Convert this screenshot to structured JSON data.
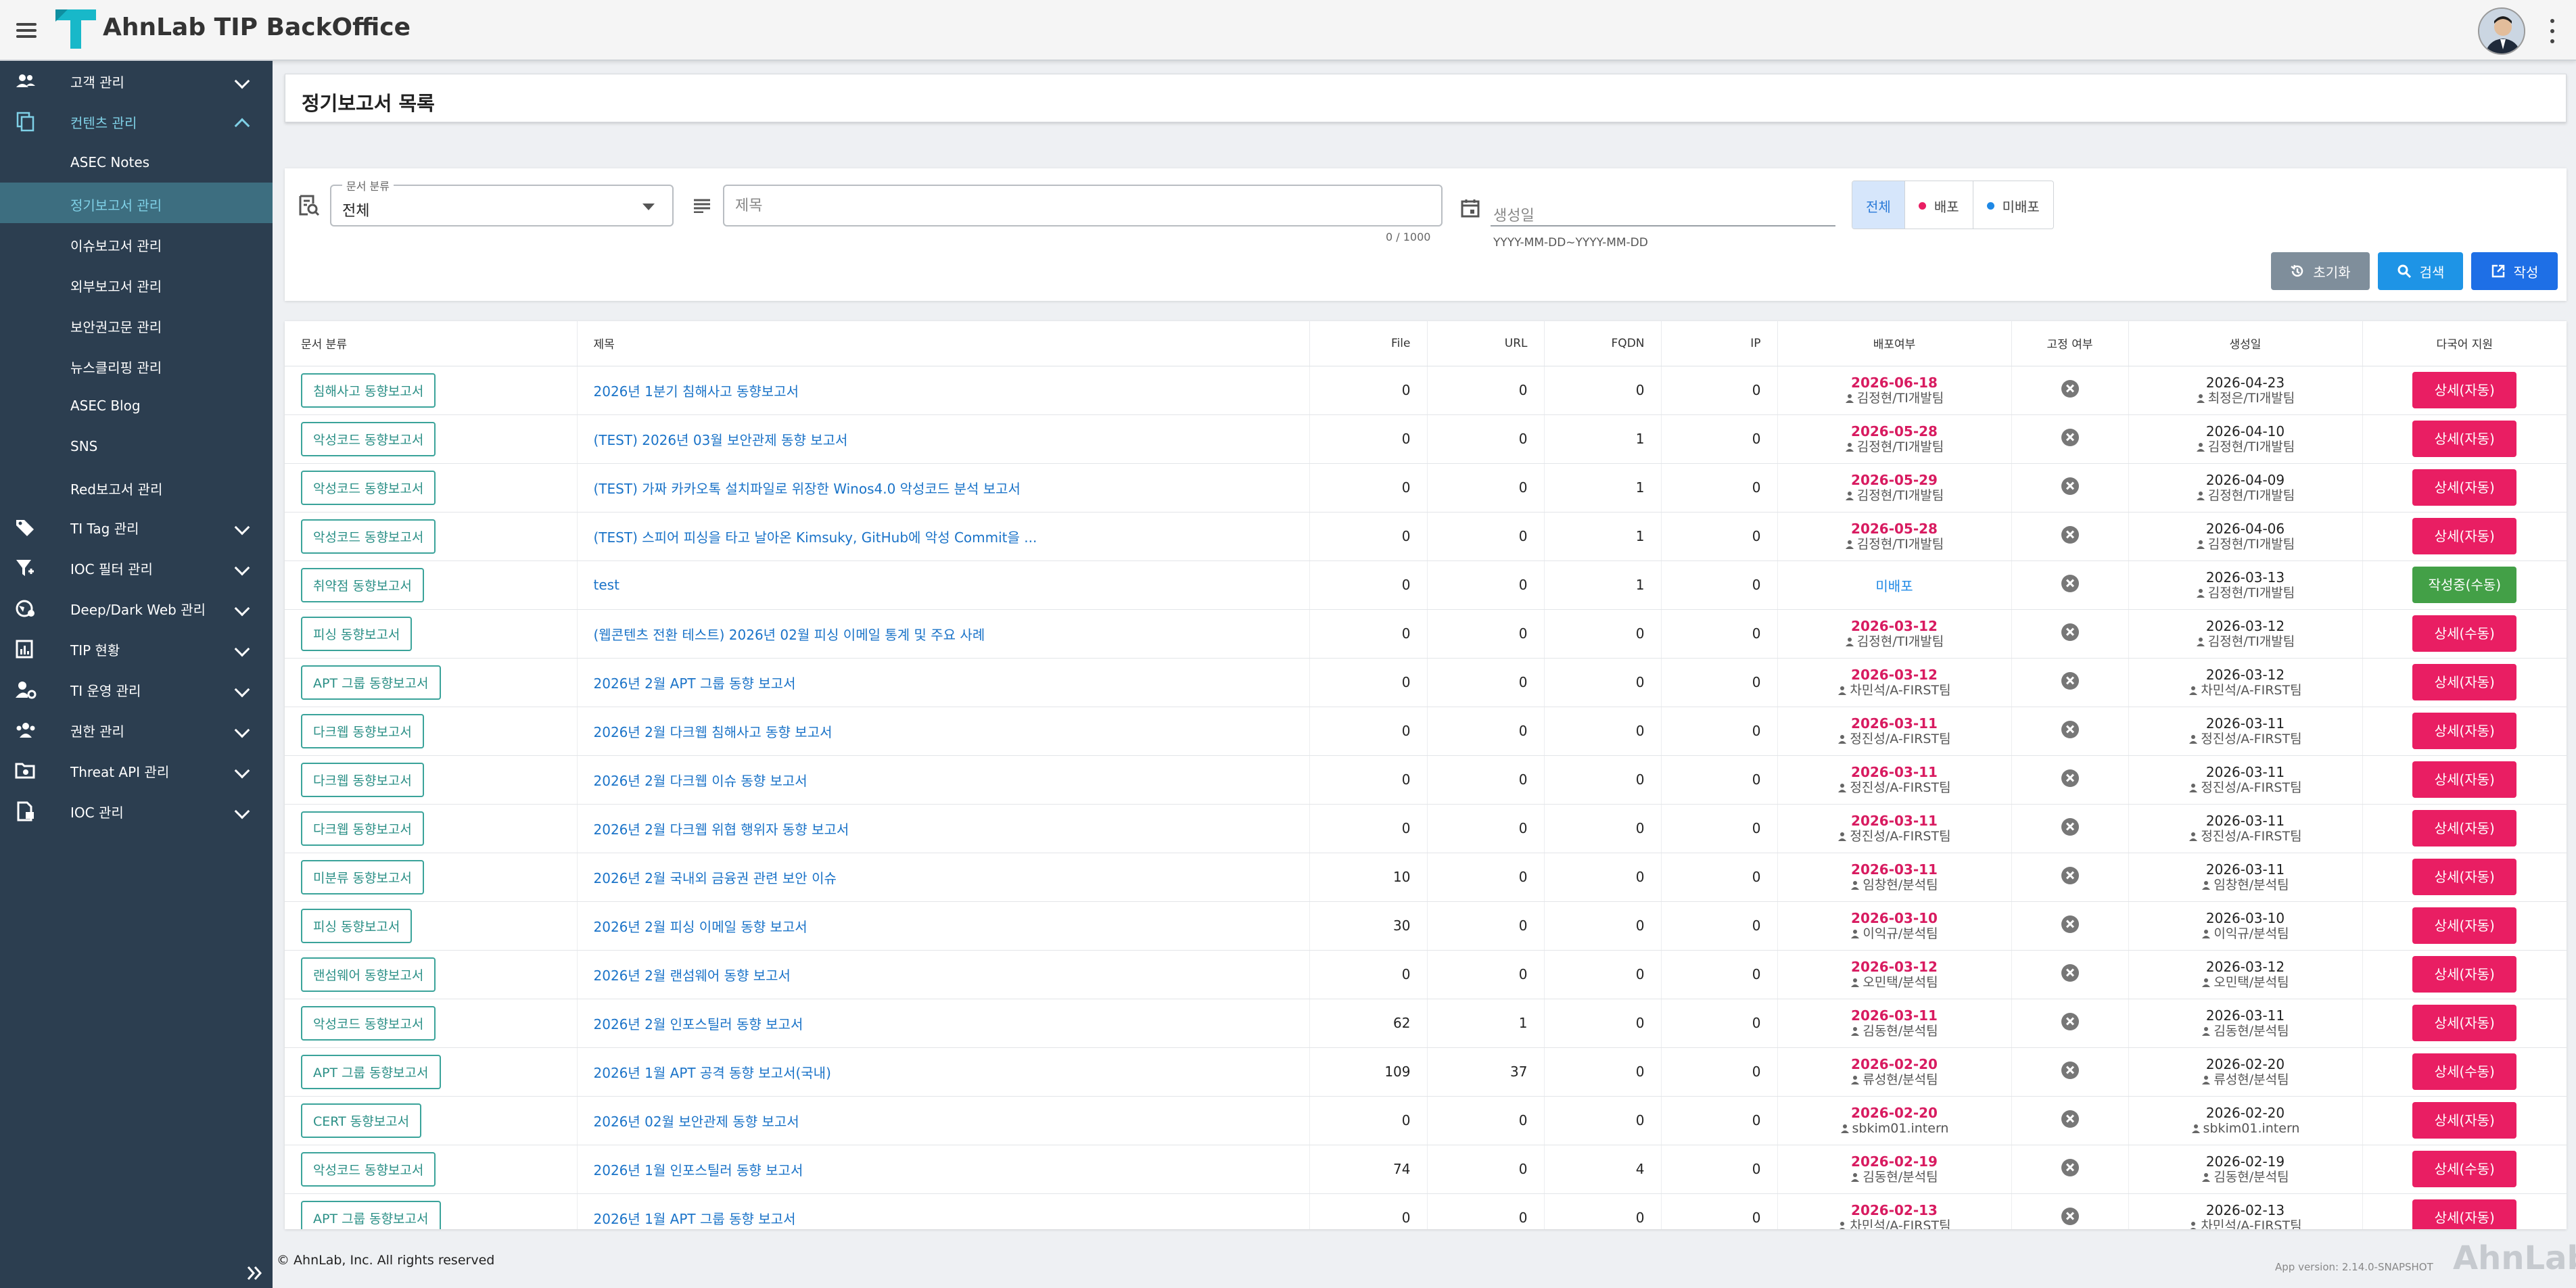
{
  "app": {
    "title": "AhnLab TIP BackOffice"
  },
  "colors": {
    "sidebar_bg": "#2c3e50",
    "accent": "#7fd0e6",
    "deploy_date": "#d81b60",
    "pink_button": "#e91e63",
    "green_button": "#43a047",
    "chip_border": "#3aa39a"
  },
  "sidebar": {
    "groups": [
      {
        "label": "고객 관리",
        "icon": "users-icon",
        "expanded": false
      },
      {
        "label": "컨텐츠 관리",
        "icon": "copy-icon",
        "expanded": true,
        "items": [
          "ASEC Notes",
          "정기보고서 관리",
          "이슈보고서 관리",
          "외부보고서 관리",
          "보안권고문 관리",
          "뉴스클리핑 관리",
          "ASEC Blog",
          "SNS",
          "Red보고서 관리"
        ],
        "active_item": "정기보고서 관리"
      },
      {
        "label": "TI Tag 관리",
        "icon": "tag-icon",
        "expanded": false
      },
      {
        "label": "IOC 필터 관리",
        "icon": "filter-icon",
        "expanded": false
      },
      {
        "label": "Deep/Dark Web 관리",
        "icon": "globe-icon",
        "expanded": false
      },
      {
        "label": "TIP 현황",
        "icon": "chart-icon",
        "expanded": false
      },
      {
        "label": "TI 운영 관리",
        "icon": "user-gear-icon",
        "expanded": false
      },
      {
        "label": "권한 관리",
        "icon": "group-icon",
        "expanded": false
      },
      {
        "label": "Threat API 관리",
        "icon": "folder-gear-icon",
        "expanded": false
      },
      {
        "label": "IOC 관리",
        "icon": "document-icon",
        "expanded": false
      }
    ]
  },
  "page": {
    "title": "정기보고서 목록"
  },
  "filters": {
    "category_label": "문서 분류",
    "category_value": "전체",
    "title_placeholder": "제목",
    "title_counter": "0 / 1000",
    "date_placeholder": "생성일",
    "date_helper": "YYYY-MM-DD~YYYY-MM-DD",
    "deploy_options": [
      "전체",
      "배포",
      "미배포"
    ],
    "deploy_selected": "전체",
    "reset_label": "초기화",
    "search_label": "검색",
    "write_label": "작성"
  },
  "table": {
    "headers": [
      "문서 분류",
      "제목",
      "File",
      "URL",
      "FQDN",
      "IP",
      "배포여부",
      "고정 여부",
      "생성일",
      "다국어 지원"
    ],
    "rows": [
      {
        "category": "침해사고 동향보고서",
        "title": "2026년 1분기 침해사고 동향보고서",
        "file": 0,
        "url": 0,
        "fqdn": 0,
        "ip": 0,
        "deploy_date": "2026-06-18",
        "deploy_by": "김정현/TI개발팀",
        "created": "2026-04-23",
        "created_by": "최정은/TI개발팀",
        "ml": "상세(자동)",
        "ml_color": "pink"
      },
      {
        "category": "악성코드 동향보고서",
        "title": "(TEST) 2026년 03월 보안관제 동향 보고서",
        "file": 0,
        "url": 0,
        "fqdn": 1,
        "ip": 0,
        "deploy_date": "2026-05-28",
        "deploy_by": "김정현/TI개발팀",
        "created": "2026-04-10",
        "created_by": "김정현/TI개발팀",
        "ml": "상세(자동)",
        "ml_color": "pink"
      },
      {
        "category": "악성코드 동향보고서",
        "title": "(TEST) 가짜 카카오톡 설치파일로 위장한 Winos4.0 악성코드 분석 보고서",
        "file": 0,
        "url": 0,
        "fqdn": 1,
        "ip": 0,
        "deploy_date": "2026-05-29",
        "deploy_by": "김정현/TI개발팀",
        "created": "2026-04-09",
        "created_by": "김정현/TI개발팀",
        "ml": "상세(자동)",
        "ml_color": "pink"
      },
      {
        "category": "악성코드 동향보고서",
        "title": "(TEST) 스피어 피싱을 타고 날아온 Kimsuky, GitHub에 악성 Commit을 ...",
        "file": 0,
        "url": 0,
        "fqdn": 1,
        "ip": 0,
        "deploy_date": "2026-05-28",
        "deploy_by": "김정현/TI개발팀",
        "created": "2026-04-06",
        "created_by": "김정현/TI개발팀",
        "ml": "상세(자동)",
        "ml_color": "pink"
      },
      {
        "category": "취약점 동향보고서",
        "title": "test",
        "file": 0,
        "url": 0,
        "fqdn": 1,
        "ip": 0,
        "deploy_date": "",
        "deploy_status": "미배포",
        "deploy_by": "",
        "created": "2026-03-13",
        "created_by": "김정현/TI개발팀",
        "ml": "작성중(수동)",
        "ml_color": "green"
      },
      {
        "category": "피싱 동향보고서",
        "title": "(웹콘텐츠 전환 테스트) 2026년 02월 피싱 이메일 통계 및 주요 사례",
        "file": 0,
        "url": 0,
        "fqdn": 0,
        "ip": 0,
        "deploy_date": "2026-03-12",
        "deploy_by": "김정현/TI개발팀",
        "created": "2026-03-12",
        "created_by": "김정현/TI개발팀",
        "ml": "상세(수동)",
        "ml_color": "pink"
      },
      {
        "category": "APT 그룹 동향보고서",
        "title": "2026년 2월 APT 그룹 동향 보고서",
        "file": 0,
        "url": 0,
        "fqdn": 0,
        "ip": 0,
        "deploy_date": "2026-03-12",
        "deploy_by": "차민석/A-FIRST팀",
        "created": "2026-03-12",
        "created_by": "차민석/A-FIRST팀",
        "ml": "상세(자동)",
        "ml_color": "pink"
      },
      {
        "category": "다크웹 동향보고서",
        "title": "2026년 2월 다크웹 침해사고 동향 보고서",
        "file": 0,
        "url": 0,
        "fqdn": 0,
        "ip": 0,
        "deploy_date": "2026-03-11",
        "deploy_by": "정진성/A-FIRST팀",
        "created": "2026-03-11",
        "created_by": "정진성/A-FIRST팀",
        "ml": "상세(자동)",
        "ml_color": "pink"
      },
      {
        "category": "다크웹 동향보고서",
        "title": "2026년 2월 다크웹 이슈 동향 보고서",
        "file": 0,
        "url": 0,
        "fqdn": 0,
        "ip": 0,
        "deploy_date": "2026-03-11",
        "deploy_by": "정진성/A-FIRST팀",
        "created": "2026-03-11",
        "created_by": "정진성/A-FIRST팀",
        "ml": "상세(자동)",
        "ml_color": "pink"
      },
      {
        "category": "다크웹 동향보고서",
        "title": "2026년 2월 다크웹 위협 행위자 동향 보고서",
        "file": 0,
        "url": 0,
        "fqdn": 0,
        "ip": 0,
        "deploy_date": "2026-03-11",
        "deploy_by": "정진성/A-FIRST팀",
        "created": "2026-03-11",
        "created_by": "정진성/A-FIRST팀",
        "ml": "상세(자동)",
        "ml_color": "pink"
      },
      {
        "category": "미분류 동향보고서",
        "title": "2026년 2월 국내외 금융권 관련 보안 이슈",
        "file": 10,
        "url": 0,
        "fqdn": 0,
        "ip": 0,
        "deploy_date": "2026-03-11",
        "deploy_by": "임창현/분석팀",
        "created": "2026-03-11",
        "created_by": "임창현/분석팀",
        "ml": "상세(자동)",
        "ml_color": "pink"
      },
      {
        "category": "피싱 동향보고서",
        "title": "2026년 2월 피싱 이메일 동향 보고서",
        "file": 30,
        "url": 0,
        "fqdn": 0,
        "ip": 0,
        "deploy_date": "2026-03-10",
        "deploy_by": "이익규/분석팀",
        "created": "2026-03-10",
        "created_by": "이익규/분석팀",
        "ml": "상세(자동)",
        "ml_color": "pink"
      },
      {
        "category": "랜섬웨어 동향보고서",
        "title": "2026년 2월 랜섬웨어 동향 보고서",
        "file": 0,
        "url": 0,
        "fqdn": 0,
        "ip": 0,
        "deploy_date": "2026-03-12",
        "deploy_by": "오민택/분석팀",
        "created": "2026-03-12",
        "created_by": "오민택/분석팀",
        "ml": "상세(자동)",
        "ml_color": "pink"
      },
      {
        "category": "악성코드 동향보고서",
        "title": "2026년 2월 인포스틸러 동향 보고서",
        "file": 62,
        "url": 1,
        "fqdn": 0,
        "ip": 0,
        "deploy_date": "2026-03-11",
        "deploy_by": "김동현/분석팀",
        "created": "2026-03-11",
        "created_by": "김동현/분석팀",
        "ml": "상세(자동)",
        "ml_color": "pink"
      },
      {
        "category": "APT 그룹 동향보고서",
        "title": "2026년 1월 APT 공격 동향 보고서(국내)",
        "file": 109,
        "url": 37,
        "fqdn": 0,
        "ip": 0,
        "deploy_date": "2026-02-20",
        "deploy_by": "류성현/분석팀",
        "created": "2026-02-20",
        "created_by": "류성현/분석팀",
        "ml": "상세(수동)",
        "ml_color": "pink"
      },
      {
        "category": "CERT 동향보고서",
        "title": "2026년 02월 보안관제 동향 보고서",
        "file": 0,
        "url": 0,
        "fqdn": 0,
        "ip": 0,
        "deploy_date": "2026-02-20",
        "deploy_by": "sbkim01.intern",
        "created": "2026-02-20",
        "created_by": "sbkim01.intern",
        "ml": "상세(자동)",
        "ml_color": "pink"
      },
      {
        "category": "악성코드 동향보고서",
        "title": "2026년 1월 인포스틸러 동향 보고서",
        "file": 74,
        "url": 0,
        "fqdn": 4,
        "ip": 0,
        "deploy_date": "2026-02-19",
        "deploy_by": "김동현/분석팀",
        "created": "2026-02-19",
        "created_by": "김동현/분석팀",
        "ml": "상세(수동)",
        "ml_color": "pink"
      },
      {
        "category": "APT 그룹 동향보고서",
        "title": "2026년 1월 APT 그룹 동향 보고서",
        "file": 0,
        "url": 0,
        "fqdn": 0,
        "ip": 0,
        "deploy_date": "2026-02-13",
        "deploy_by": "차민석/A-FIRST팀",
        "created": "2026-02-13",
        "created_by": "차민석/A-FIRST팀",
        "ml": "상세(자동)",
        "ml_color": "pink"
      }
    ]
  },
  "footer": {
    "copyright": "© AhnLab, Inc. All rights reserved",
    "version": "App version: 2.14.0-SNAPSHOT",
    "logo_text": "AhnLab"
  }
}
